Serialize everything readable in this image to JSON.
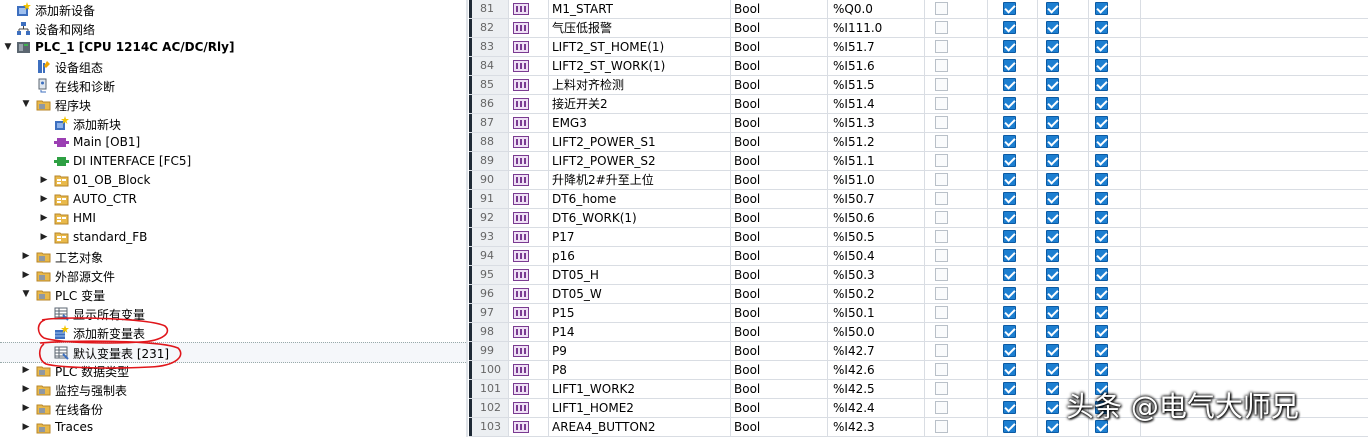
{
  "project_tree": {
    "items": [
      {
        "id": "add-device",
        "label": "添加新设备",
        "icon": "add-device-icon",
        "arrow": ""
      },
      {
        "id": "devices-networks",
        "label": "设备和网络",
        "icon": "network-icon",
        "arrow": ""
      },
      {
        "id": "plc1",
        "label": "PLC_1 [CPU 1214C AC/DC/Rly]",
        "icon": "plc-icon",
        "arrow": "expanded",
        "bold": true
      },
      {
        "id": "device-config",
        "label": "设备组态",
        "icon": "device-config-icon",
        "arrow": ""
      },
      {
        "id": "online-diag",
        "label": "在线和诊断",
        "icon": "diagnostics-icon",
        "arrow": ""
      },
      {
        "id": "program-blocks",
        "label": "程序块",
        "icon": "folder-icon",
        "arrow": "expanded"
      },
      {
        "id": "add-block",
        "label": "添加新块",
        "icon": "add-block-icon",
        "arrow": ""
      },
      {
        "id": "main-ob1",
        "label": "Main [OB1]",
        "icon": "ob-block-icon",
        "arrow": ""
      },
      {
        "id": "di-interface",
        "label": "DI INTERFACE [FC5]",
        "icon": "fc-block-icon",
        "arrow": ""
      },
      {
        "id": "ob-block",
        "label": "01_OB_Block",
        "icon": "group-folder-icon",
        "arrow": "collapsed"
      },
      {
        "id": "auto-ctr",
        "label": "AUTO_CTR",
        "icon": "group-folder-icon",
        "arrow": "collapsed"
      },
      {
        "id": "hmi",
        "label": "HMI",
        "icon": "group-folder-icon",
        "arrow": "collapsed"
      },
      {
        "id": "standard-fb",
        "label": "standard_FB",
        "icon": "group-folder-icon",
        "arrow": "collapsed"
      },
      {
        "id": "tech-objects",
        "label": "工艺对象",
        "icon": "folder-icon",
        "arrow": "collapsed"
      },
      {
        "id": "external-sources",
        "label": "外部源文件",
        "icon": "folder-icon",
        "arrow": "collapsed"
      },
      {
        "id": "plc-tags",
        "label": "PLC 变量",
        "icon": "folder-icon",
        "arrow": "expanded"
      },
      {
        "id": "show-all-tags",
        "label": "显示所有变量",
        "icon": "tag-table-icon",
        "arrow": ""
      },
      {
        "id": "add-tag-table",
        "label": "添加新变量表",
        "icon": "add-tag-table-icon",
        "arrow": ""
      },
      {
        "id": "default-tag-table",
        "label": "默认变量表 [231]",
        "icon": "tag-table-icon",
        "arrow": ""
      },
      {
        "id": "plc-data-types",
        "label": "PLC 数据类型",
        "icon": "folder-icon",
        "arrow": "collapsed"
      },
      {
        "id": "watch-force",
        "label": "监控与强制表",
        "icon": "folder-icon",
        "arrow": "collapsed"
      },
      {
        "id": "online-backup",
        "label": "在线备份",
        "icon": "folder-icon",
        "arrow": "collapsed"
      },
      {
        "id": "traces",
        "label": "Traces",
        "icon": "folder-icon",
        "arrow": "collapsed"
      }
    ]
  },
  "tag_table": {
    "rows": [
      {
        "num": "81",
        "name": "M1_START",
        "type": "Bool",
        "address": "%Q0.0"
      },
      {
        "num": "82",
        "name": "气压低报警",
        "type": "Bool",
        "address": "%I111.0"
      },
      {
        "num": "83",
        "name": "LIFT2_ST_HOME(1)",
        "type": "Bool",
        "address": "%I51.7"
      },
      {
        "num": "84",
        "name": "LIFT2_ST_WORK(1)",
        "type": "Bool",
        "address": "%I51.6"
      },
      {
        "num": "85",
        "name": "上料对齐检测",
        "type": "Bool",
        "address": "%I51.5"
      },
      {
        "num": "86",
        "name": "接近开关2",
        "type": "Bool",
        "address": "%I51.4"
      },
      {
        "num": "87",
        "name": "EMG3",
        "type": "Bool",
        "address": "%I51.3"
      },
      {
        "num": "88",
        "name": "LIFT2_POWER_S1",
        "type": "Bool",
        "address": "%I51.2"
      },
      {
        "num": "89",
        "name": "LIFT2_POWER_S2",
        "type": "Bool",
        "address": "%I51.1"
      },
      {
        "num": "90",
        "name": "升降机2#升至上位",
        "type": "Bool",
        "address": "%I51.0"
      },
      {
        "num": "91",
        "name": "DT6_home",
        "type": "Bool",
        "address": "%I50.7"
      },
      {
        "num": "92",
        "name": "DT6_WORK(1)",
        "type": "Bool",
        "address": "%I50.6"
      },
      {
        "num": "93",
        "name": "P17",
        "type": "Bool",
        "address": "%I50.5"
      },
      {
        "num": "94",
        "name": "p16",
        "type": "Bool",
        "address": "%I50.4"
      },
      {
        "num": "95",
        "name": "DT05_H",
        "type": "Bool",
        "address": "%I50.3"
      },
      {
        "num": "96",
        "name": "DT05_W",
        "type": "Bool",
        "address": "%I50.2"
      },
      {
        "num": "97",
        "name": "P15",
        "type": "Bool",
        "address": "%I50.1"
      },
      {
        "num": "98",
        "name": "P14",
        "type": "Bool",
        "address": "%I50.0"
      },
      {
        "num": "99",
        "name": "P9",
        "type": "Bool",
        "address": "%I42.7"
      },
      {
        "num": "100",
        "name": "P8",
        "type": "Bool",
        "address": "%I42.6"
      },
      {
        "num": "101",
        "name": "LIFT1_WORK2",
        "type": "Bool",
        "address": "%I42.5"
      },
      {
        "num": "102",
        "name": "LIFT1_HOME2",
        "type": "Bool",
        "address": "%I42.4"
      },
      {
        "num": "103",
        "name": "AREA4_BUTTON2",
        "type": "Bool",
        "address": "%I42.3"
      }
    ],
    "retain_checked": false,
    "accessible_hmi_checked": true,
    "writable_hmi_checked": true,
    "visible_hmi_checked": true
  },
  "colors": {
    "checkbox_blue": "#1d7fd1",
    "annotation_red": "#e0161b",
    "tree_selected": "#f5f7fa"
  },
  "watermark": {
    "text": "头条 @电气大师兄"
  }
}
